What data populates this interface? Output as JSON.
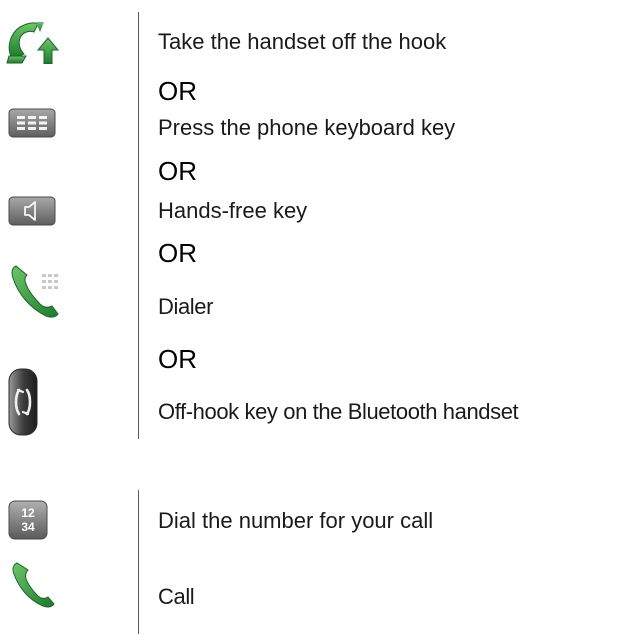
{
  "step1": {
    "instructions": [
      "Take the handset off the hook",
      "Press the phone keyboard key",
      "Hands-free key",
      "Dialer",
      "Off-hook key on the Bluetooth handset"
    ],
    "separator": "OR",
    "icons": [
      "handset-off-hook-icon",
      "phone-keyboard-key-icon",
      "hands-free-key-icon",
      "dialer-icon",
      "bluetooth-handset-off-hook-icon"
    ]
  },
  "step2": {
    "instructions": [
      "Dial the number for your call",
      "Call"
    ],
    "keypad_icon": {
      "top": "12",
      "bottom": "34"
    },
    "icons": [
      "keypad-icon",
      "call-icon"
    ]
  },
  "colors": {
    "green": "#2e9a3a",
    "key_grey": "#8a8a8a",
    "divider": "#5a5a5a"
  }
}
